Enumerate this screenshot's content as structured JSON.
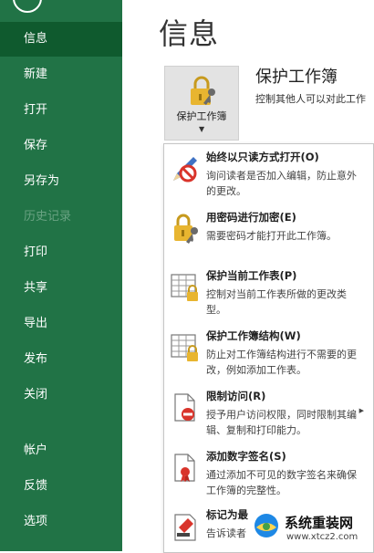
{
  "sidebar": {
    "items": [
      {
        "label": "信息"
      },
      {
        "label": "新建"
      },
      {
        "label": "打开"
      },
      {
        "label": "保存"
      },
      {
        "label": "另存为"
      },
      {
        "label": "历史记录"
      },
      {
        "label": "打印"
      },
      {
        "label": "共享"
      },
      {
        "label": "导出"
      },
      {
        "label": "发布"
      },
      {
        "label": "关闭"
      },
      {
        "label": "帐户"
      },
      {
        "label": "反馈"
      },
      {
        "label": "选项"
      }
    ]
  },
  "main": {
    "title": "信息",
    "protect_button_label": "保护工作簿",
    "section_title": "保护工作簿",
    "section_desc": "控制其他人可以对此工作"
  },
  "dropdown": {
    "items": [
      {
        "title": "始终以只读方式打开(O)",
        "desc": "询问读者是否加入编辑，防止意外的更改。"
      },
      {
        "title": "用密码进行加密(E)",
        "desc": "需要密码才能打开此工作簿。"
      },
      {
        "title": "保护当前工作表(P)",
        "desc": "控制对当前工作表所做的更改类型。"
      },
      {
        "title": "保护工作簿结构(W)",
        "desc": "防止对工作簿结构进行不需要的更改，例如添加工作表。"
      },
      {
        "title": "限制访问(R)",
        "desc": "授予用户访问权限，同时限制其编辑、复制和打印能力。"
      },
      {
        "title": "添加数字签名(S)",
        "desc": "通过添加不可见的数字签名来确保工作簿的完整性。"
      },
      {
        "title": "标记为最终",
        "desc": "告诉读者"
      }
    ]
  },
  "watermark": {
    "name": "系统重装网",
    "url": "www.xtcz2.com"
  },
  "colors": {
    "sidebar": "#217346",
    "sidebar_active": "#0f5a2e",
    "accent": "#217346"
  }
}
